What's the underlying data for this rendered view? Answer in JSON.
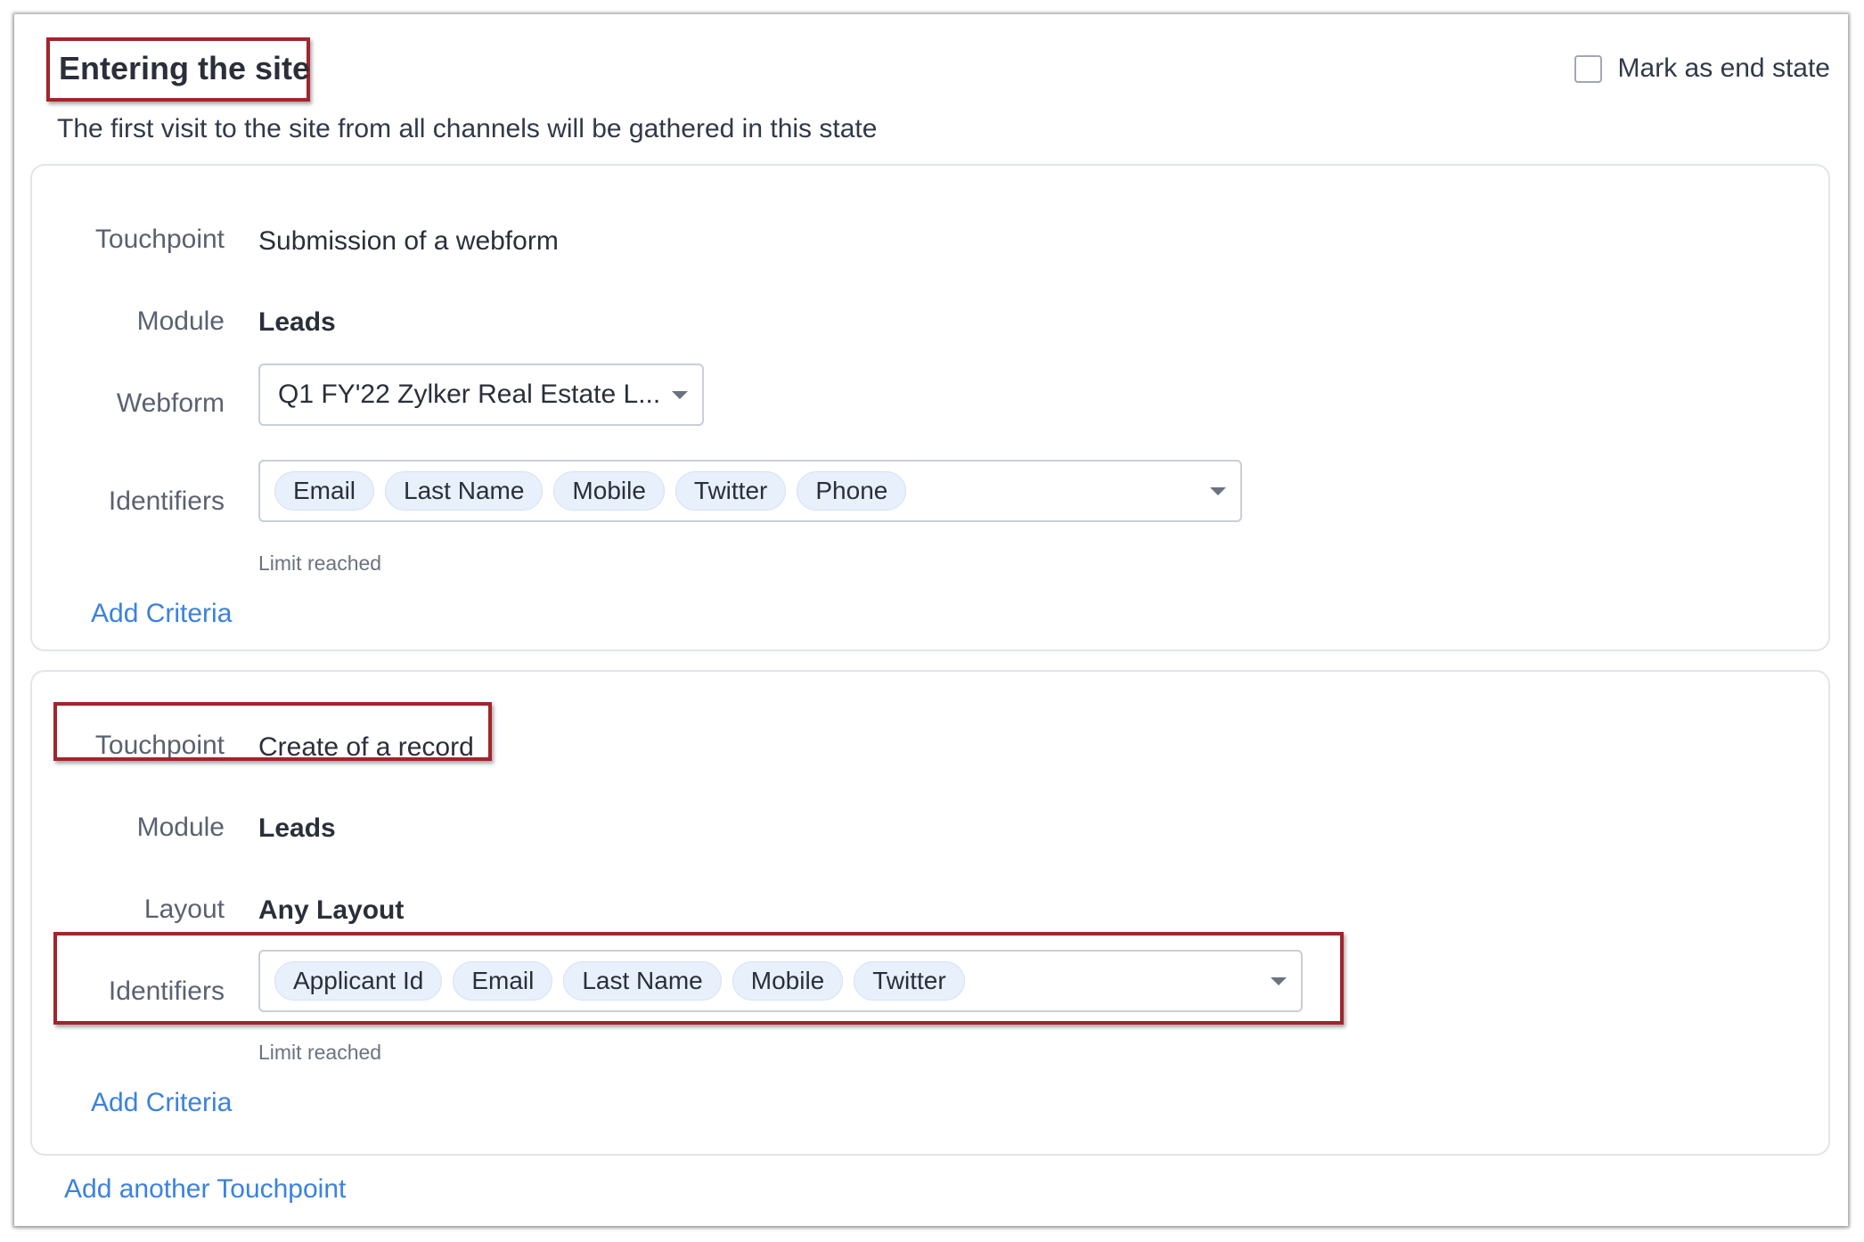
{
  "header": {
    "title": "Entering the site",
    "subtitle": "The first visit to the site from all channels will be gathered in this state",
    "end_state_label": "Mark as end state",
    "end_state_checked": false
  },
  "touchpoint1": {
    "touchpoint_label": "Touchpoint",
    "touchpoint_value": "Submission of a webform",
    "module_label": "Module",
    "module_value": "Leads",
    "webform_label": "Webform",
    "webform_value": "Q1 FY'22 Zylker Real Estate L...",
    "identifiers_label": "Identifiers",
    "identifiers": [
      "Email",
      "Last Name",
      "Mobile",
      "Twitter",
      "Phone"
    ],
    "limit_text": "Limit reached",
    "add_criteria": "Add Criteria"
  },
  "touchpoint2": {
    "touchpoint_label": "Touchpoint",
    "touchpoint_value": "Create of a record",
    "module_label": "Module",
    "module_value": "Leads",
    "layout_label": "Layout",
    "layout_value": "Any Layout",
    "identifiers_label": "Identifiers",
    "identifiers": [
      "Applicant Id",
      "Email",
      "Last Name",
      "Mobile",
      "Twitter"
    ],
    "limit_text": "Limit reached",
    "add_criteria": "Add Criteria"
  },
  "footer": {
    "add_touchpoint": "Add another Touchpoint"
  },
  "colors": {
    "highlight_border": "#a1252b",
    "link": "#3a82e0",
    "chip_bg": "#e8f0fb"
  }
}
